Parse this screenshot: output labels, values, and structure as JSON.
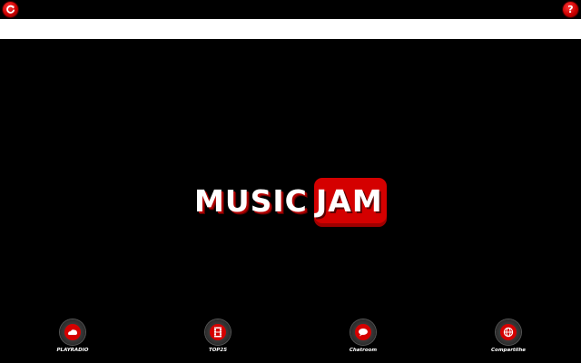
{
  "header": {
    "refresh_icon": "refresh-icon",
    "help_icon": "help-icon",
    "help_glyph": "?"
  },
  "address_bar": {
    "value": "",
    "placeholder": ""
  },
  "logo": {
    "part1": "MUSIC",
    "part2": "JAM"
  },
  "nav": [
    {
      "label": "PLAYRADIO",
      "icon": "radio-icon"
    },
    {
      "label": "TOP25",
      "icon": "film-icon"
    },
    {
      "label": "Chatroom",
      "icon": "chat-icon"
    },
    {
      "label": "Compartilhe",
      "icon": "globe-icon"
    }
  ],
  "colors": {
    "background": "#000000",
    "accent": "#d40000",
    "address_bar": "#ffffff",
    "text": "#ffffff"
  }
}
